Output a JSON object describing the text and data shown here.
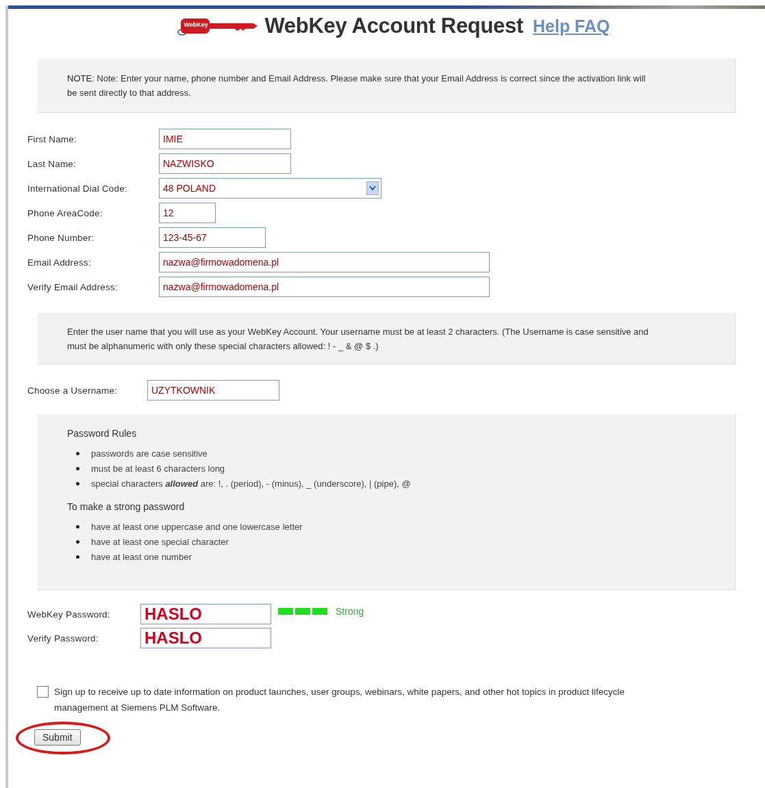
{
  "header": {
    "title": "WebKey Account Request",
    "help_link": "Help FAQ",
    "logo_text": "WebKey"
  },
  "note": {
    "label": "NOTE:",
    "text": "Note: Enter your name, phone number and Email Address. Please make sure  that your Email Address is correct since the activation link will be sent directly to that address."
  },
  "fields": [
    {
      "label": "First Name:",
      "value": "IMIE",
      "kind": "text"
    },
    {
      "label": "Last Name:",
      "value": "NAZWISKO",
      "kind": "text"
    },
    {
      "label": "International Dial Code:",
      "value": "48 POLAND",
      "kind": "select"
    },
    {
      "label": "Phone AreaCode:",
      "value": "12",
      "kind": "text"
    },
    {
      "label": "Phone Number:",
      "value": "123-45-67",
      "kind": "text"
    },
    {
      "label": "Email Address:",
      "value": "nazwa@firmowadomena.pl",
      "kind": "text"
    },
    {
      "label": "Verify Email Address:",
      "value": "nazwa@firmowadomena.pl",
      "kind": "text"
    }
  ],
  "username_note": "Enter the user name that you will use as your WebKey Account. Your username must be at least 2 characters. (The Username  is  case  sensitive  and  must  be  alphanumeric with only these special characters allowed: ! - _ & @ $ .)",
  "username": {
    "label": "Choose a Username:",
    "value": "UZYTKOWNIK"
  },
  "password_rules": {
    "heading": "Password Rules",
    "items": [
      "passwords  are  case  sensitive",
      "must be at least 6 characters long",
      "special characters **allowed** are: !, . (period), - (minus), _ (underscore), | (pipe), @"
    ],
    "strong_heading": "To make a strong password",
    "strong_items": [
      "have at least one uppercase and one lowercase  letter",
      "have at least one special character",
      "have at least one number"
    ]
  },
  "password": {
    "label": "WebKey Password:",
    "value": "HASLO",
    "strength": {
      "level": 1,
      "label": "Strong"
    }
  },
  "verify_password": {
    "label": "Verify Password:",
    "value": "HASLO"
  },
  "newsletter": {
    "checked": false,
    "text": "Sign up to receive up to date information on product launches, user groups, webinars, white papers, and other hot topics in product lifecycle management at Siemens PLM Software."
  },
  "submit": {
    "label": "Submit",
    "highlighted": true
  }
}
